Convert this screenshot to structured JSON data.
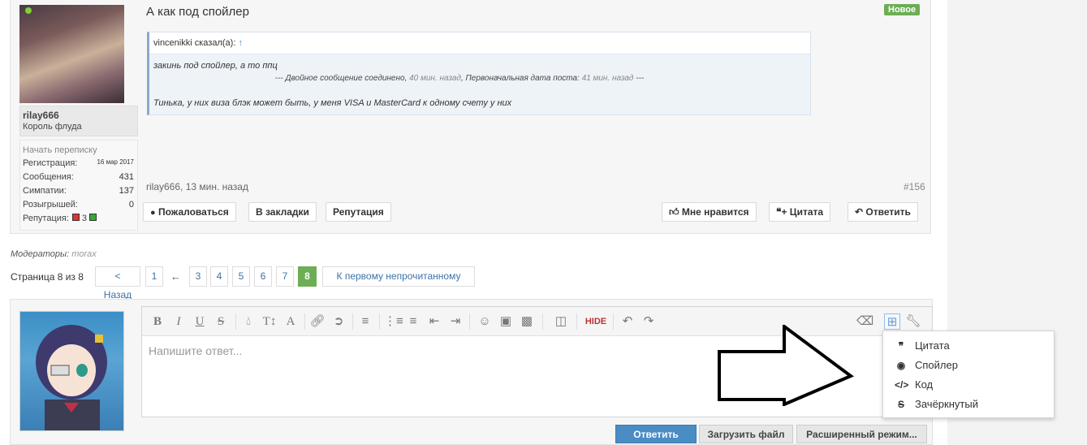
{
  "post": {
    "user": {
      "name": "rilay666",
      "title": "Король флуда"
    },
    "stats": {
      "pm_link": "Начать переписку",
      "registration_label": "Регистрация:",
      "registration_value": "16 мар 2017",
      "messages_label": "Сообщения:",
      "messages_value": "431",
      "likes_label": "Симпатии:",
      "likes_value": "137",
      "giveaways_label": "Розыгрышей:",
      "giveaways_value": "0",
      "reputation_label": "Репутация:",
      "reputation_value": "3"
    },
    "title": "А как под спойлер",
    "badge": "Новое",
    "quote": {
      "author": "vincenikki сказал(а):",
      "arrow": "↑",
      "line1": "закинь под спойлер, а то ппц",
      "merge_prefix": "--- Двойное сообщение соединено,",
      "merge_time": "40 мин. назад",
      "merge_mid": ", Первоначальная дата поста:",
      "merge_orig": "41 мин. назад",
      "merge_suffix": "---",
      "line2": "Тинька, у них виза блэк может быть, у меня VISA и MasterCard к одному счету у них"
    },
    "meta": "rilay666, 13 мин. назад",
    "number": "#156",
    "buttons": {
      "report": "Пожаловаться",
      "bookmark": "В закладки",
      "reputation": "Репутация",
      "like": "Мне нравится",
      "quote": "+ Цитата",
      "reply": "Ответить"
    }
  },
  "moderators": {
    "label": "Модераторы:",
    "name": "morax"
  },
  "pager": {
    "label": "Страница 8 из 8",
    "prev": "< Назад",
    "pages": [
      "1",
      "3",
      "4",
      "5",
      "6",
      "7",
      "8"
    ],
    "dots": "←",
    "current": "8",
    "first_unread": "К первому непрочитанному"
  },
  "editor": {
    "placeholder": "Напишите ответ...",
    "toolbar": [
      "bold",
      "italic",
      "underline",
      "strike",
      "color",
      "font-size",
      "font-family",
      "link",
      "unlink",
      "align",
      "bullet-list",
      "numbered-list",
      "outdent",
      "indent",
      "smilies",
      "image",
      "media",
      "draft",
      "hide",
      "undo",
      "redo",
      "remove-format",
      "insert-menu",
      "tools"
    ],
    "hide_label": "HIDE",
    "dropdown": [
      {
        "label": "Цитата",
        "icon": "quote-icon"
      },
      {
        "label": "Спойлер",
        "icon": "spoiler-icon"
      },
      {
        "label": "Код",
        "icon": "code-icon"
      },
      {
        "label": "Зачёркнутый",
        "icon": "strikethrough-icon"
      }
    ]
  },
  "reply_buttons": {
    "reply": "Ответить",
    "upload": "Загрузить файл",
    "advanced": "Расширенный режим..."
  },
  "colors": {
    "accent": "#4b86c4",
    "badge": "#6cae54",
    "reply_button": "#4a8cc4"
  }
}
